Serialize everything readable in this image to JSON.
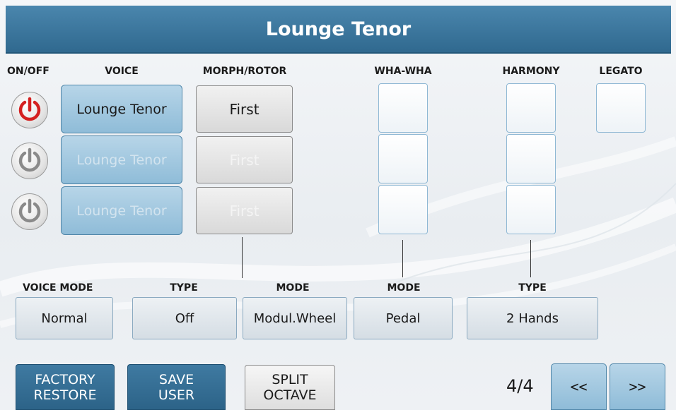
{
  "title": "Lounge Tenor",
  "headers": {
    "on_off": "ON/OFF",
    "voice": "VOICE",
    "morph_rotor": "MORPH/ROTOR",
    "wha_wha": "WHA-WHA",
    "harmony": "HARMONY",
    "legato": "LEGATO"
  },
  "layers": [
    {
      "power": "on",
      "voice": "Lounge Tenor",
      "morph": "First"
    },
    {
      "power": "off",
      "voice": "Lounge Tenor",
      "morph": "First"
    },
    {
      "power": "off",
      "voice": "Lounge Tenor",
      "morph": "First"
    }
  ],
  "sub_headers": {
    "voice_mode": "VOICE MODE",
    "type": "TYPE",
    "morph_mode": "MODE",
    "wha_mode": "MODE",
    "harmony_type": "TYPE"
  },
  "selectors": {
    "voice_mode": "Normal",
    "type": "Off",
    "morph_mode": "Modul.Wheel",
    "wha_mode": "Pedal",
    "harmony_type": "2 Hands"
  },
  "actions": {
    "factory_restore": [
      "FACTORY",
      "RESTORE"
    ],
    "save_user": [
      "SAVE",
      "USER"
    ],
    "split_octave": [
      "SPLIT",
      "OCTAVE"
    ]
  },
  "page_indicator": "4/4",
  "nav": {
    "prev": "<<",
    "next": ">>"
  },
  "colors": {
    "title_bar": "#3a76a0",
    "power_on": "#d42020",
    "power_off": "#8a8a8a",
    "action_button": "#346e95"
  }
}
